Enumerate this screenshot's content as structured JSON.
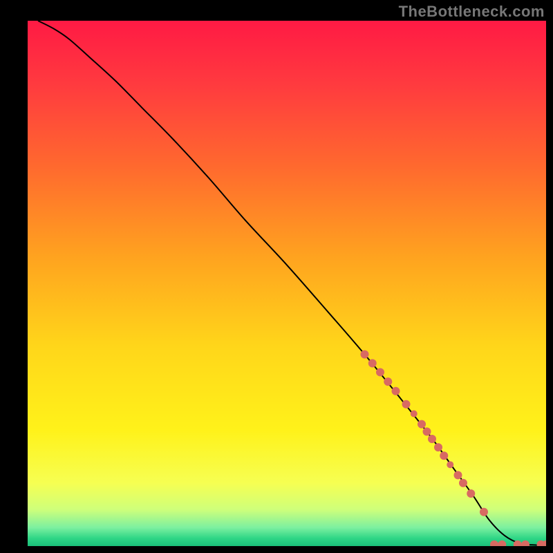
{
  "attribution": "TheBottleneck.com",
  "chart_data": {
    "type": "line",
    "title": "",
    "xlabel": "",
    "ylabel": "",
    "xlim": [
      0,
      100
    ],
    "ylim": [
      0,
      100
    ],
    "background_gradient": {
      "stops": [
        {
          "offset": 0.0,
          "color": "#ff1a44"
        },
        {
          "offset": 0.12,
          "color": "#ff3a3f"
        },
        {
          "offset": 0.28,
          "color": "#ff6a2e"
        },
        {
          "offset": 0.45,
          "color": "#ffa31f"
        },
        {
          "offset": 0.62,
          "color": "#ffd61a"
        },
        {
          "offset": 0.78,
          "color": "#fff21a"
        },
        {
          "offset": 0.88,
          "color": "#f6ff52"
        },
        {
          "offset": 0.93,
          "color": "#cfff7a"
        },
        {
          "offset": 0.965,
          "color": "#7cf0a0"
        },
        {
          "offset": 0.985,
          "color": "#2fd686"
        },
        {
          "offset": 1.0,
          "color": "#1abf7a"
        }
      ]
    },
    "series": [
      {
        "name": "curve",
        "kind": "line",
        "color": "#000000",
        "x": [
          2,
          5,
          8,
          12,
          17,
          22,
          28,
          35,
          42,
          50,
          58,
          65,
          72,
          78,
          82,
          86,
          89,
          92,
          95,
          98,
          100
        ],
        "y": [
          100,
          98.5,
          96.5,
          93,
          88.5,
          83.5,
          77.5,
          70,
          62,
          53.5,
          44.5,
          36.5,
          28,
          20.5,
          15,
          9.5,
          5,
          2,
          0.5,
          0.2,
          0.2
        ]
      },
      {
        "name": "points",
        "kind": "scatter",
        "color": "#d86a62",
        "points": [
          {
            "x": 65.0,
            "y": 36.5,
            "r": 6
          },
          {
            "x": 66.5,
            "y": 34.8,
            "r": 6
          },
          {
            "x": 68.0,
            "y": 33.1,
            "r": 6
          },
          {
            "x": 69.5,
            "y": 31.3,
            "r": 6
          },
          {
            "x": 71.0,
            "y": 29.5,
            "r": 6
          },
          {
            "x": 73.0,
            "y": 27.0,
            "r": 6
          },
          {
            "x": 74.5,
            "y": 25.2,
            "r": 5
          },
          {
            "x": 76.0,
            "y": 23.2,
            "r": 6
          },
          {
            "x": 77.0,
            "y": 21.8,
            "r": 6
          },
          {
            "x": 78.0,
            "y": 20.4,
            "r": 6
          },
          {
            "x": 79.2,
            "y": 18.8,
            "r": 6
          },
          {
            "x": 80.3,
            "y": 17.2,
            "r": 6
          },
          {
            "x": 81.5,
            "y": 15.5,
            "r": 5
          },
          {
            "x": 83.0,
            "y": 13.5,
            "r": 6
          },
          {
            "x": 84.0,
            "y": 12.0,
            "r": 6
          },
          {
            "x": 85.5,
            "y": 10.0,
            "r": 6
          },
          {
            "x": 88.0,
            "y": 6.5,
            "r": 6
          },
          {
            "x": 90.0,
            "y": 0.3,
            "r": 6
          },
          {
            "x": 91.5,
            "y": 0.3,
            "r": 6
          },
          {
            "x": 94.5,
            "y": 0.3,
            "r": 6
          },
          {
            "x": 96.0,
            "y": 0.3,
            "r": 6
          },
          {
            "x": 99.0,
            "y": 0.3,
            "r": 6
          },
          {
            "x": 100.0,
            "y": 0.3,
            "r": 6
          }
        ]
      }
    ]
  }
}
